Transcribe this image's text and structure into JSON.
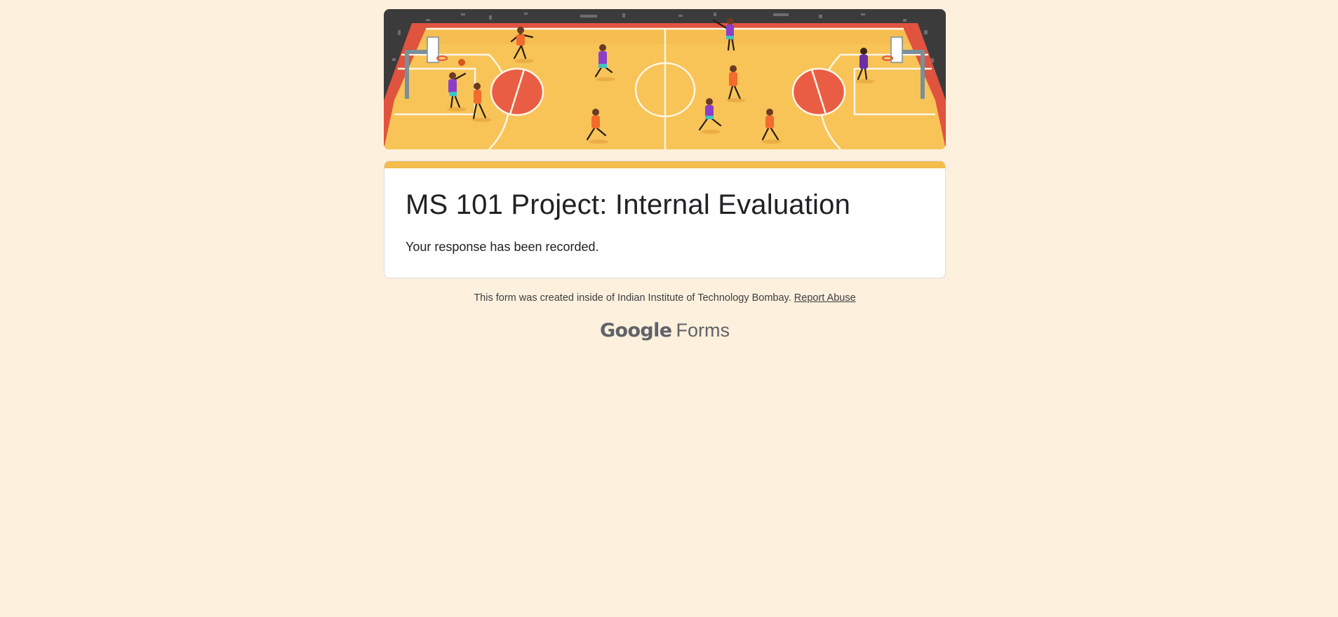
{
  "form": {
    "title": "MS 101 Project: Internal Evaluation",
    "confirmation_message": "Your response has been recorded."
  },
  "footer": {
    "created_text": "This form was created inside of Indian Institute of Technology Bombay.",
    "report_abuse_label": "Report Abuse"
  },
  "branding": {
    "google_word": "Google",
    "forms_word": "Forms"
  },
  "colors": {
    "page_background": "#fdf0dc",
    "accent": "#f3bc4c",
    "court": "#f8c458",
    "court_paint": "#ea5d45"
  }
}
